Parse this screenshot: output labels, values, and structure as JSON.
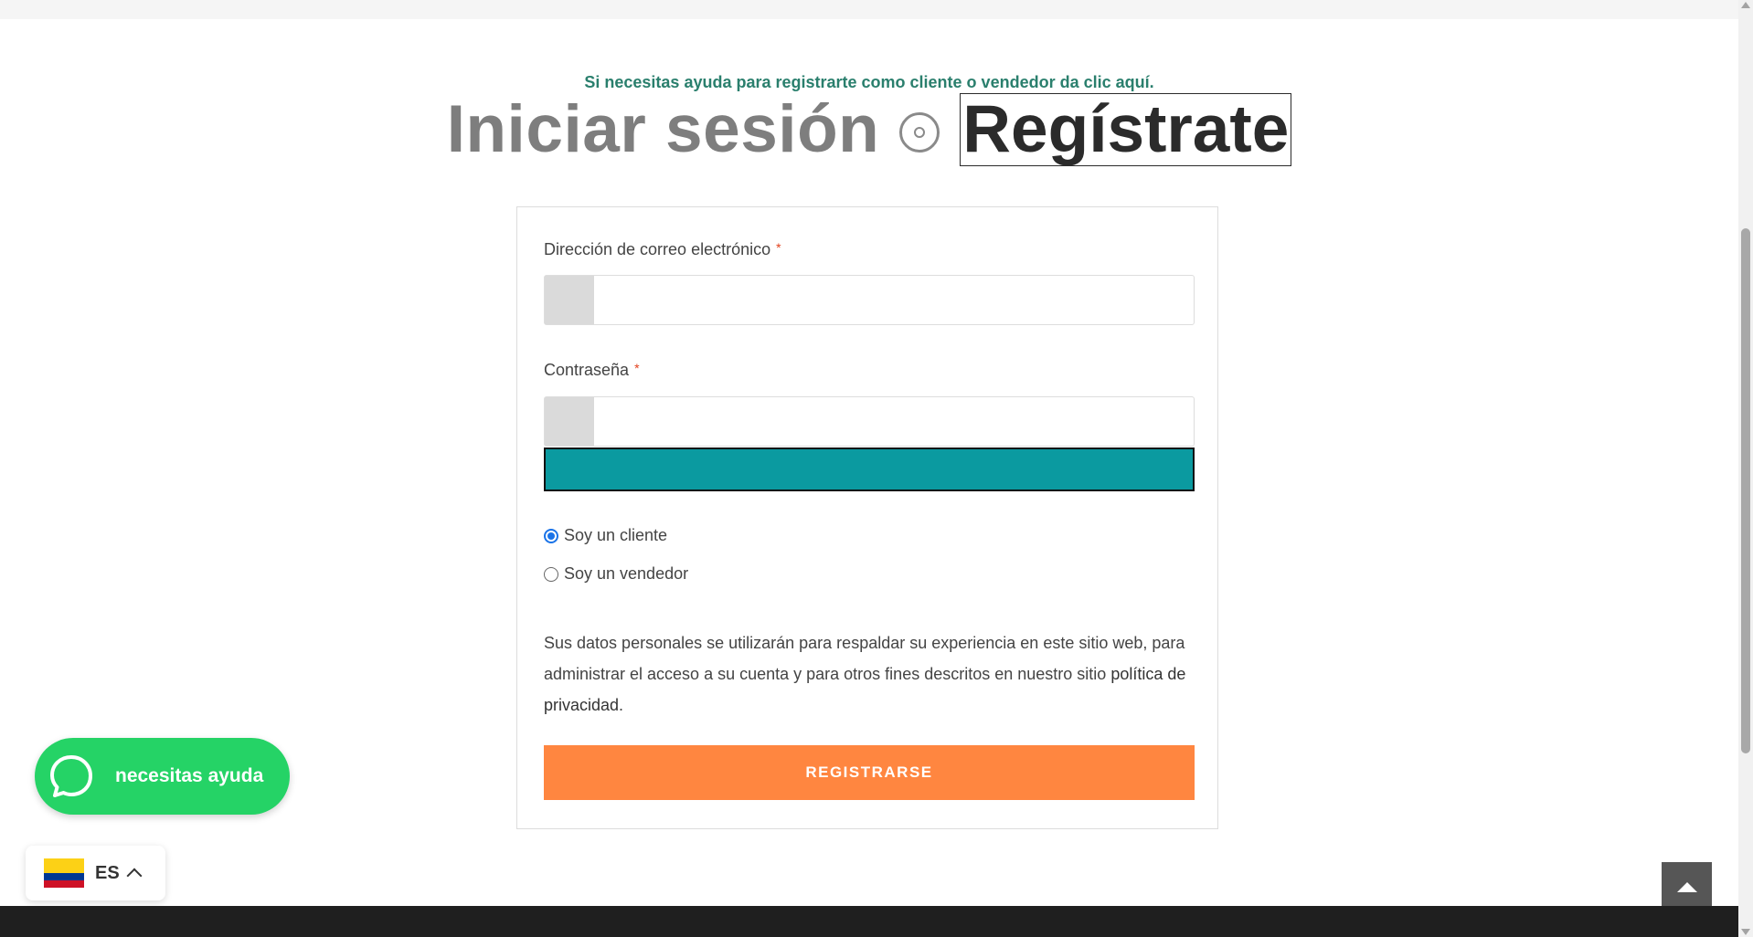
{
  "help_link": "Si necesitas ayuda para registrarte como cliente o vendedor da clic aquí.",
  "tabs": {
    "login": "Iniciar sesión",
    "register": "Regístrate"
  },
  "form": {
    "email_label": "Dirección de correo electrónico",
    "password_label": "Contraseña",
    "required_mark": "*",
    "email_value": "",
    "password_value": "",
    "role_options": [
      {
        "label": "Soy un cliente",
        "selected": true
      },
      {
        "label": "Soy un vendedor",
        "selected": false
      }
    ],
    "privacy_text": "Sus datos personales se utilizarán para respaldar su experiencia en este sitio web, para administrar el acceso a su cuenta y para otros fines descritos en nuestro sitio ",
    "privacy_link": "política de privacidad",
    "privacy_end": ".",
    "submit_label": "REGISTRARSE"
  },
  "whatsapp": {
    "label": "necesitas ayuda",
    "icon": "whatsapp-chat-icon"
  },
  "language": {
    "code": "ES",
    "flag": "colombia-flag-icon"
  },
  "colors": {
    "accent": "#ff8640",
    "teal": "#0b9aa0",
    "whatsapp": "#25d366",
    "link": "#2a7f6d"
  }
}
